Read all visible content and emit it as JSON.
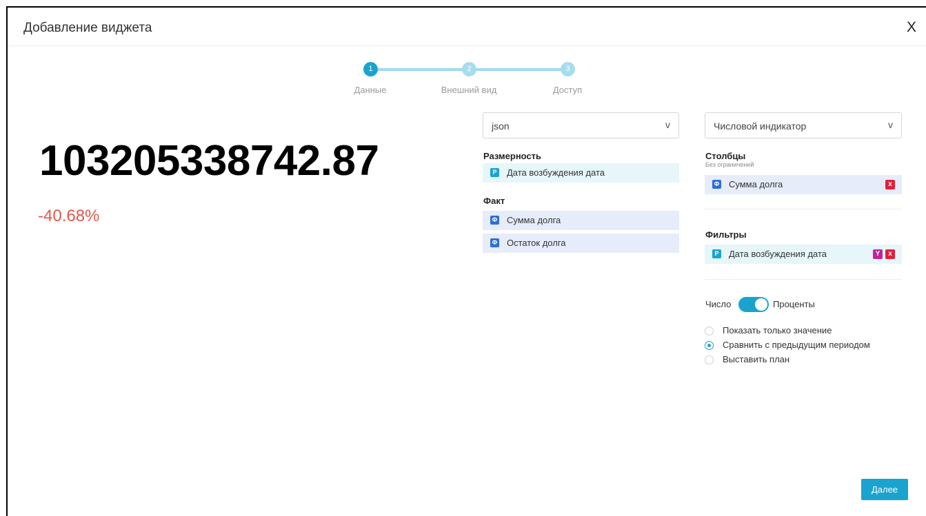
{
  "dialog": {
    "title": "Добавление виджета",
    "close_label": "X"
  },
  "stepper": {
    "steps": [
      {
        "number": "1",
        "label": "Данные",
        "state": "active"
      },
      {
        "number": "2",
        "label": "Внешний вид",
        "state": "inactive"
      },
      {
        "number": "3",
        "label": "Доступ",
        "state": "inactive"
      }
    ]
  },
  "preview": {
    "value": "103205338742.87",
    "change": "-40.68%"
  },
  "data_panel": {
    "source_select": {
      "value": "json",
      "chevron": "v"
    },
    "dimension_label": "Размерность",
    "dimensions": [
      {
        "badge": "P",
        "label": "Дата возбуждения дата"
      }
    ],
    "fact_label": "Факт",
    "facts": [
      {
        "badge": "Ф",
        "label": "Сумма долга"
      },
      {
        "badge": "Ф",
        "label": "Остаток долга"
      }
    ]
  },
  "config_panel": {
    "type_select": {
      "value": "Числовой индикатор",
      "chevron": "v"
    },
    "columns_label": "Столбцы",
    "columns_sub": "Без ограничений",
    "columns": [
      {
        "badge": "Ф",
        "label": "Сумма долга",
        "remove_icon": "x"
      }
    ],
    "filters_label": "Фильтры",
    "filters": [
      {
        "badge": "P",
        "label": "Дата возбуждения дата",
        "filter_icon": "Y",
        "remove_icon": "x"
      }
    ],
    "toggle": {
      "left_label": "Число",
      "right_label": "Проценты",
      "state": "on"
    },
    "radios": [
      {
        "label": "Показать только значение",
        "checked": false
      },
      {
        "label": "Сравнить с предыдущим периодом",
        "checked": true
      },
      {
        "label": "Выставить план",
        "checked": false
      }
    ]
  },
  "footer": {
    "next_label": "Далее"
  },
  "colors": {
    "accent": "#1aa3cf",
    "negative": "#e4574c",
    "remove": "#e0203a",
    "filter": "#c0249c",
    "dimension_bg": "#e6f6f9",
    "fact_bg": "#e6ecfa"
  }
}
